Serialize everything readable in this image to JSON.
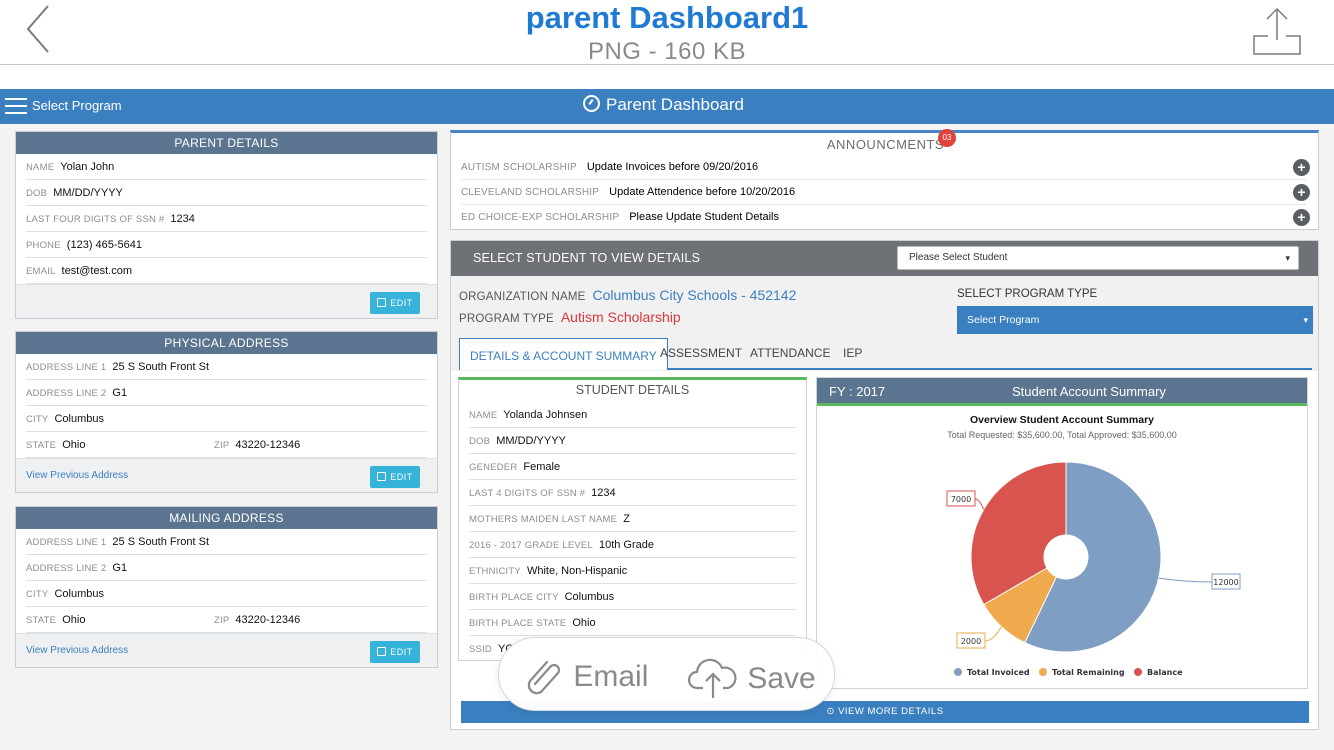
{
  "preview": {
    "title": "parent Dashboard1",
    "meta": "PNG - 160 KB"
  },
  "topbar": {
    "menu_label": "Select Program",
    "title": "Parent Dashboard"
  },
  "parent_details": {
    "title": "PARENT DETAILS",
    "rows": [
      {
        "label": "NAME",
        "value": "Yolan John"
      },
      {
        "label": "DOB",
        "value": "MM/DD/YYYY"
      },
      {
        "label": "LAST FOUR DIGITS OF SSN #",
        "value": "1234"
      },
      {
        "label": "PHONE",
        "value": "(123) 465-5641"
      },
      {
        "label": "EMAIL",
        "value": "test@test.com"
      }
    ],
    "edit_label": "EDIT"
  },
  "physical_address": {
    "title": "PHYSICAL ADDRESS",
    "line1_label": "ADDRESS LINE 1",
    "line1": "25 S South Front St",
    "line2_label": "ADDRESS LINE 2",
    "line2": "G1",
    "city_label": "CITY",
    "city": "Columbus",
    "state_label": "STATE",
    "state": "Ohio",
    "zip_label": "ZIP",
    "zip": "43220-12346",
    "link": "View Previous Address",
    "edit_label": "EDIT"
  },
  "mailing_address": {
    "title": "MAILING ADDRESS",
    "line1_label": "ADDRESS LINE 1",
    "line1": "25 S South Front St",
    "line2_label": "ADDRESS LINE 2",
    "line2": "G1",
    "city_label": "CITY",
    "city": "Columbus",
    "state_label": "STATE",
    "state": "Ohio",
    "zip_label": "ZIP",
    "zip": "43220-12346",
    "link": "View Previous Address",
    "edit_label": "EDIT"
  },
  "announcements": {
    "title": "ANNOUNCMENTS",
    "badge": "03",
    "items": [
      {
        "label": "AUTISM SCHOLARSHIP",
        "text": "Update Invoices before 09/20/2016"
      },
      {
        "label": "CLEVELAND SCHOLARSHIP",
        "text": "Update Attendence before 10/20/2016"
      },
      {
        "label": "ED CHOICE-EXP SCHOLARSHIP",
        "text": "Please Update Student Details"
      }
    ]
  },
  "student_panel": {
    "header": "SELECT STUDENT TO VIEW DETAILS",
    "student_select": "Please Select Student",
    "org_label": "ORGANIZATION NAME",
    "org_value": "Columbus City Schools - 452142",
    "program_type_label": "PROGRAM TYPE",
    "program_type_value": "Autism Scholarship",
    "select_program_label": "SELECT PROGRAM TYPE",
    "select_program_value": "Select Program",
    "tabs": [
      "DETAILS & ACCOUNT SUMMARY",
      "ASSESSMENT",
      "ATTENDANCE",
      "IEP"
    ]
  },
  "student_details": {
    "title": "STUDENT DETAILS",
    "rows": [
      {
        "label": "NAME",
        "value": "Yolanda Johnsen"
      },
      {
        "label": "DOB",
        "value": "MM/DD/YYYY"
      },
      {
        "label": "GENEDER",
        "value": "Female"
      },
      {
        "label": "LAST 4 DIGITS OF SSN #",
        "value": "1234"
      },
      {
        "label": "MOTHERS MAIDEN LAST NAME",
        "value": "Z"
      },
      {
        "label": "2016 - 2017 GRADE LEVEL",
        "value": "10th Grade"
      },
      {
        "label": "ETHNICITY",
        "value": "White, Non-Hispanic"
      },
      {
        "label": "BIRTH PLACE CITY",
        "value": "Columbus"
      },
      {
        "label": "BIRTH PLACE STATE",
        "value": "Ohio"
      },
      {
        "label": "SSID",
        "value": "YC"
      }
    ]
  },
  "account_summary": {
    "fy": "FY : 2017",
    "title": "Student Account Summary",
    "chart_title": "Overview Student Account Summary",
    "chart_subtitle": "Total Requested: $35,600.00, Total Approved: $35,600.00"
  },
  "chart_data": {
    "type": "pie",
    "title": "Overview Student Account Summary",
    "subtitle": "Total Requested: $35,600.00, Total Approved: $35,600.00",
    "series": [
      {
        "name": "Total Invoiced",
        "value": 12000,
        "color": "#7f9ec3"
      },
      {
        "name": "Total Remaining",
        "value": 2000,
        "color": "#efaa4d"
      },
      {
        "name": "Balance",
        "value": 7000,
        "color": "#d9534f"
      }
    ],
    "legend_position": "bottom",
    "donut": true
  },
  "footer": {
    "view_more": "VIEW MORE DETAILS",
    "email": "Email",
    "save": "Save"
  },
  "colors": {
    "brand_blue": "#3a7fc0",
    "card_header": "#5b7590",
    "edit_button": "#36b3d8",
    "accent_green": "#5cb85c",
    "badge_red": "#e0433b"
  }
}
